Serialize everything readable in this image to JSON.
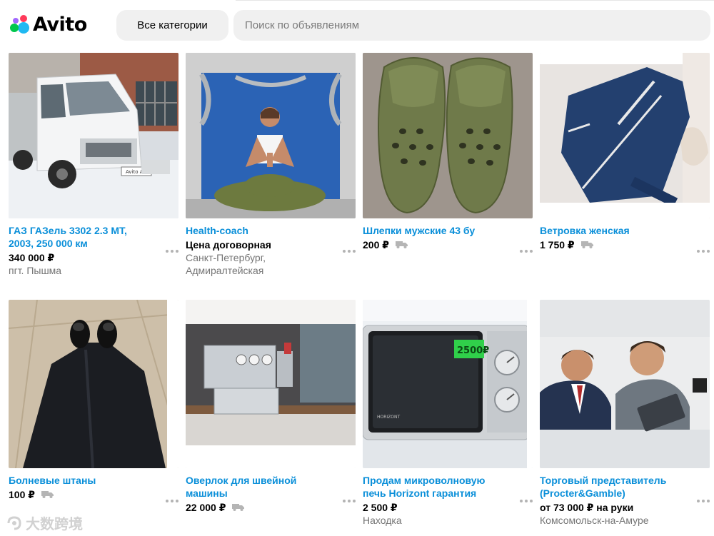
{
  "header": {
    "logo_text": "Avito",
    "categories_label": "Все категории",
    "search_placeholder": "Поиск по объявлениям"
  },
  "listings": [
    {
      "title": "ГАЗ ГАЗель 3302 2.3 MT, 2003, 250 000 км",
      "price": "340 000 ₽",
      "delivery": false,
      "location": [
        "пгт. Пышма"
      ]
    },
    {
      "title": "Health-coach",
      "price": "Цена договорная",
      "delivery": false,
      "location": [
        "Санкт-Петербург,",
        "Адмиралтейская"
      ]
    },
    {
      "title": "Шлепки мужские 43 бу",
      "price": "200 ₽",
      "delivery": true,
      "location": []
    },
    {
      "title": "Ветровка женская",
      "price": "1 750 ₽",
      "delivery": true,
      "location": []
    },
    {
      "title": "Болневые штаны",
      "price": "100 ₽",
      "delivery": true,
      "location": []
    },
    {
      "title": "Оверлок для швейной машины",
      "price": "22 000 ₽",
      "delivery": true,
      "location": []
    },
    {
      "title": "Продам микроволновую печь Horizont гарантия",
      "price": "2 500 ₽",
      "delivery": false,
      "location": [
        "Находка"
      ]
    },
    {
      "title": "Торговый представитель (Procter&Gamble)",
      "price": "от 73 000 ₽ на руки",
      "delivery": false,
      "location": [
        "Комсомольск-на-Амуре"
      ]
    }
  ],
  "photo_texts": {
    "van_plate": "Avito Auto",
    "microwave_display": "2500₽",
    "microwave_brand": "HORIZONT"
  },
  "watermark": "大数跨境",
  "colors": {
    "title_link": "#0a8fd9",
    "muted": "#757575",
    "search_bg": "#f0f0f0"
  }
}
